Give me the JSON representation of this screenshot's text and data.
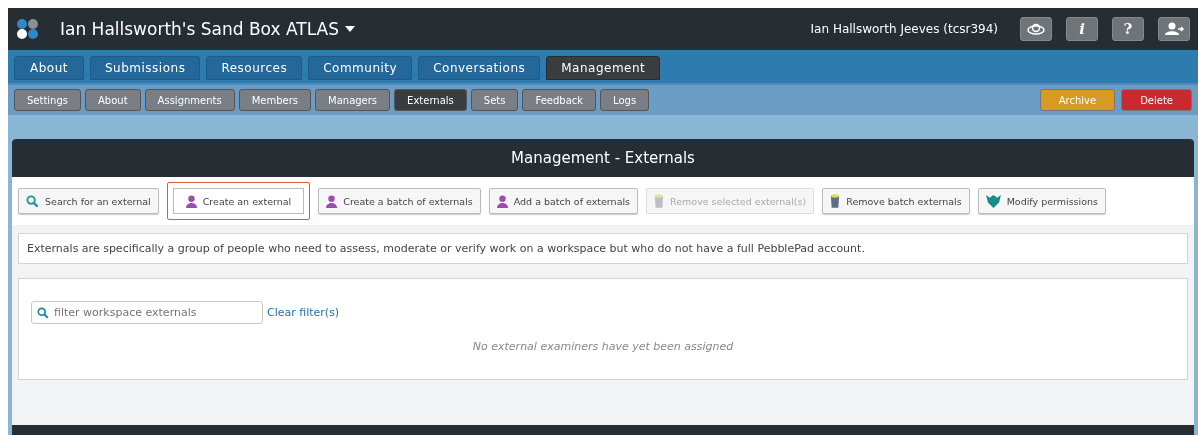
{
  "header": {
    "title": "Ian Hallsworth's Sand Box ATLAS",
    "user": "Ian Hallsworth Jeeves (tcsr394)",
    "icon_buttons": [
      {
        "kind": "cloud"
      },
      {
        "kind": "info",
        "label": "i"
      },
      {
        "kind": "help",
        "label": "?"
      },
      {
        "kind": "logout"
      }
    ]
  },
  "tabs": [
    {
      "label": "About",
      "selected": false
    },
    {
      "label": "Submissions",
      "selected": false
    },
    {
      "label": "Resources",
      "selected": false
    },
    {
      "label": "Community",
      "selected": false
    },
    {
      "label": "Conversations",
      "selected": false
    },
    {
      "label": "Management",
      "selected": true
    }
  ],
  "subtabs": [
    {
      "label": "Settings",
      "selected": false
    },
    {
      "label": "About",
      "selected": false
    },
    {
      "label": "Assignments",
      "selected": false
    },
    {
      "label": "Members",
      "selected": false
    },
    {
      "label": "Managers",
      "selected": false
    },
    {
      "label": "Externals",
      "selected": true
    },
    {
      "label": "Sets",
      "selected": false
    },
    {
      "label": "Feedback",
      "selected": false
    },
    {
      "label": "Logs",
      "selected": false
    }
  ],
  "page_actions": [
    {
      "label": "Archive",
      "kind": "warning"
    },
    {
      "label": "Delete",
      "kind": "danger"
    }
  ],
  "panel": {
    "title": "Management - Externals",
    "actions": [
      {
        "label": "Search for an external",
        "kind": "search",
        "disabled": false,
        "highlighted": false
      },
      {
        "label": "Create an external",
        "kind": "person",
        "disabled": false,
        "highlighted": true
      },
      {
        "label": "Create a batch of externals",
        "kind": "person",
        "disabled": false,
        "highlighted": false
      },
      {
        "label": "Add a batch of externals",
        "kind": "person",
        "disabled": false,
        "highlighted": false
      },
      {
        "label": "Remove selected external(s)",
        "kind": "bin",
        "disabled": true,
        "highlighted": false
      },
      {
        "label": "Remove batch externals",
        "kind": "bin",
        "disabled": false,
        "highlighted": false
      },
      {
        "label": "Modify permissions",
        "kind": "shield",
        "disabled": false,
        "highlighted": false
      }
    ],
    "description": "Externals are specifically a group of people who need to assess, moderate or verify work on a workspace but who do not have a full PebblePad account.",
    "filter": {
      "placeholder": "filter workspace externals"
    },
    "clear_link": "Clear filter(s)",
    "empty_message": "No external examiners have yet been assigned"
  }
}
